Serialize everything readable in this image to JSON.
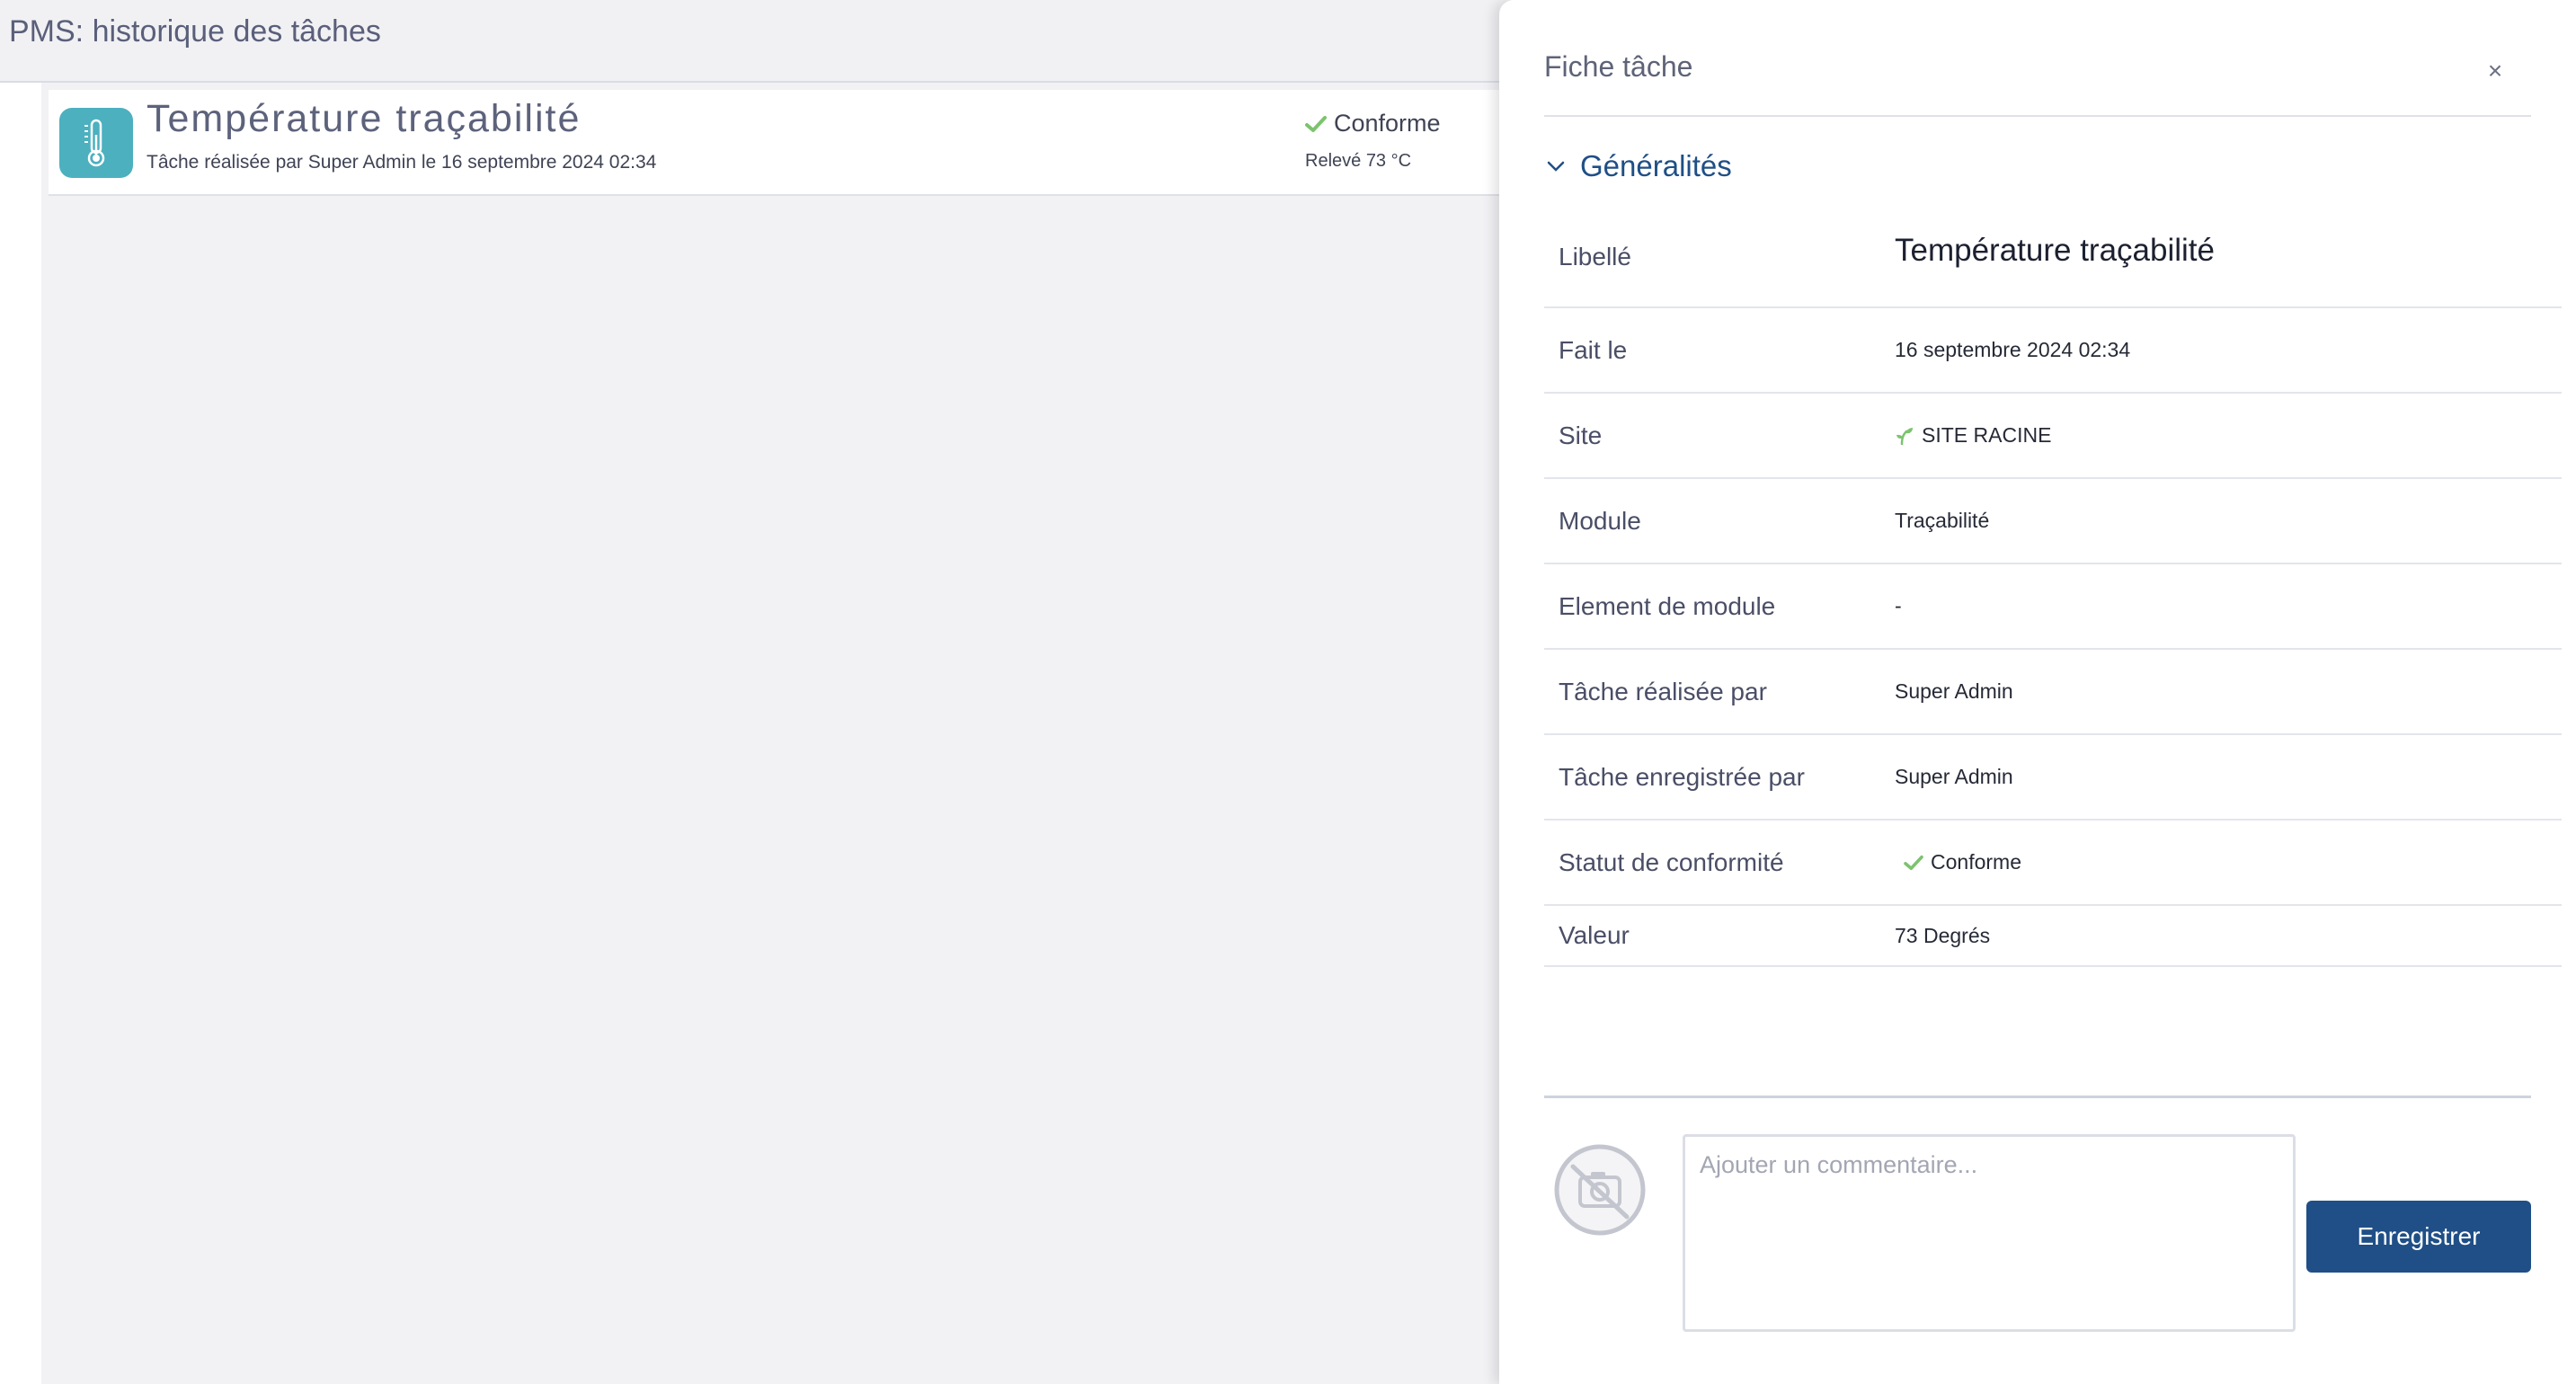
{
  "page": {
    "title": "PMS: historique des tâches"
  },
  "task_list": {
    "items": [
      {
        "title": "Température traçabilité",
        "subtitle": "Tâche réalisée par Super Admin le 16 septembre 2024 02:34",
        "status": "Conforme",
        "releve": "Relevé 73 °C",
        "icon": "thermometer-icon"
      }
    ]
  },
  "drawer": {
    "title": "Fiche tâche",
    "close_label": "×",
    "section": {
      "title": "Généralités"
    },
    "details": {
      "libelle": {
        "label": "Libellé",
        "value": "Température traçabilité"
      },
      "fait_le": {
        "label": "Fait le",
        "value": "16 septembre 2024 02:34"
      },
      "site": {
        "label": "Site",
        "value": "SITE RACINE",
        "icon": "sprout-icon"
      },
      "module": {
        "label": "Module",
        "value": "Traçabilité"
      },
      "element": {
        "label": "Element de module",
        "value": "-"
      },
      "realisee_par": {
        "label": "Tâche réalisée par",
        "value": "Super Admin"
      },
      "enregistree_par": {
        "label": "Tâche enregistrée par",
        "value": "Super Admin"
      },
      "statut": {
        "label": "Statut de conformité",
        "value": "Conforme",
        "icon": "check-icon"
      },
      "valeur": {
        "label": "Valeur",
        "value": "73 Degrés"
      }
    },
    "comment": {
      "placeholder": "Ajouter un commentaire...",
      "value": ""
    },
    "save_label": "Enregistrer"
  },
  "colors": {
    "accent": "#1f4f86",
    "task_icon_bg": "#4cb0bf",
    "check_green": "#7cc36e",
    "text_muted": "#5e6378"
  }
}
